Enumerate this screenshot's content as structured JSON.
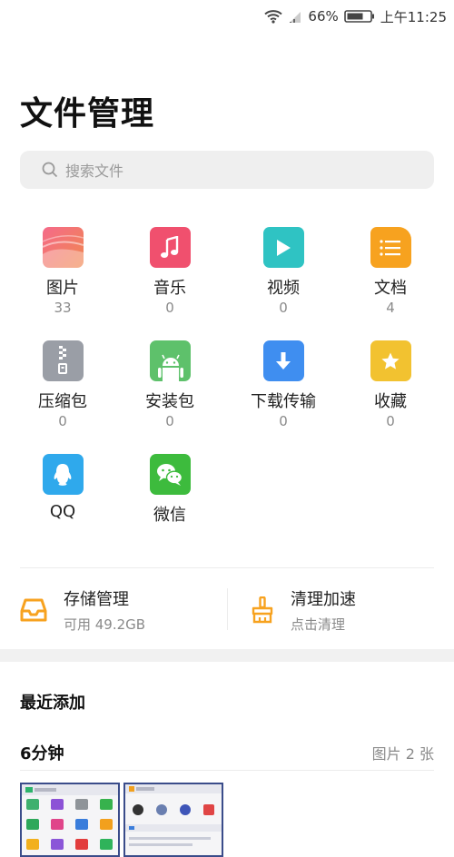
{
  "status_bar": {
    "battery_pct": "66%",
    "time": "上午11:25"
  },
  "title": "文件管理",
  "search": {
    "placeholder": "搜索文件"
  },
  "categories": [
    {
      "label": "图片",
      "count": "33",
      "icon": "image-icon",
      "color": "#f06a6a"
    },
    {
      "label": "音乐",
      "count": "0",
      "icon": "music-icon",
      "color": "#f0506e"
    },
    {
      "label": "视频",
      "count": "0",
      "icon": "video-icon",
      "color": "#2fc3c3"
    },
    {
      "label": "文档",
      "count": "4",
      "icon": "document-icon",
      "color": "#f7a21f"
    },
    {
      "label": "压缩包",
      "count": "0",
      "icon": "zip-icon",
      "color": "#9a9ea6"
    },
    {
      "label": "安装包",
      "count": "0",
      "icon": "android-icon",
      "color": "#5ec16b"
    },
    {
      "label": "下载传输",
      "count": "0",
      "icon": "download-icon",
      "color": "#3f8ef0"
    },
    {
      "label": "收藏",
      "count": "0",
      "icon": "star-icon",
      "color": "#f2c230"
    },
    {
      "label": "QQ",
      "icon": "qq-icon",
      "color": "#2fa9ec"
    },
    {
      "label": "微信",
      "icon": "wechat-icon",
      "color": "#3dbb3d"
    }
  ],
  "storage": {
    "title": "存储管理",
    "subtitle": "可用 49.2GB"
  },
  "cleanup": {
    "title": "清理加速",
    "subtitle": "点击清理"
  },
  "recent": {
    "title": "最近添加",
    "group_time": "6分钟",
    "group_meta": "图片 2 张"
  },
  "accent": "#f7a21f"
}
